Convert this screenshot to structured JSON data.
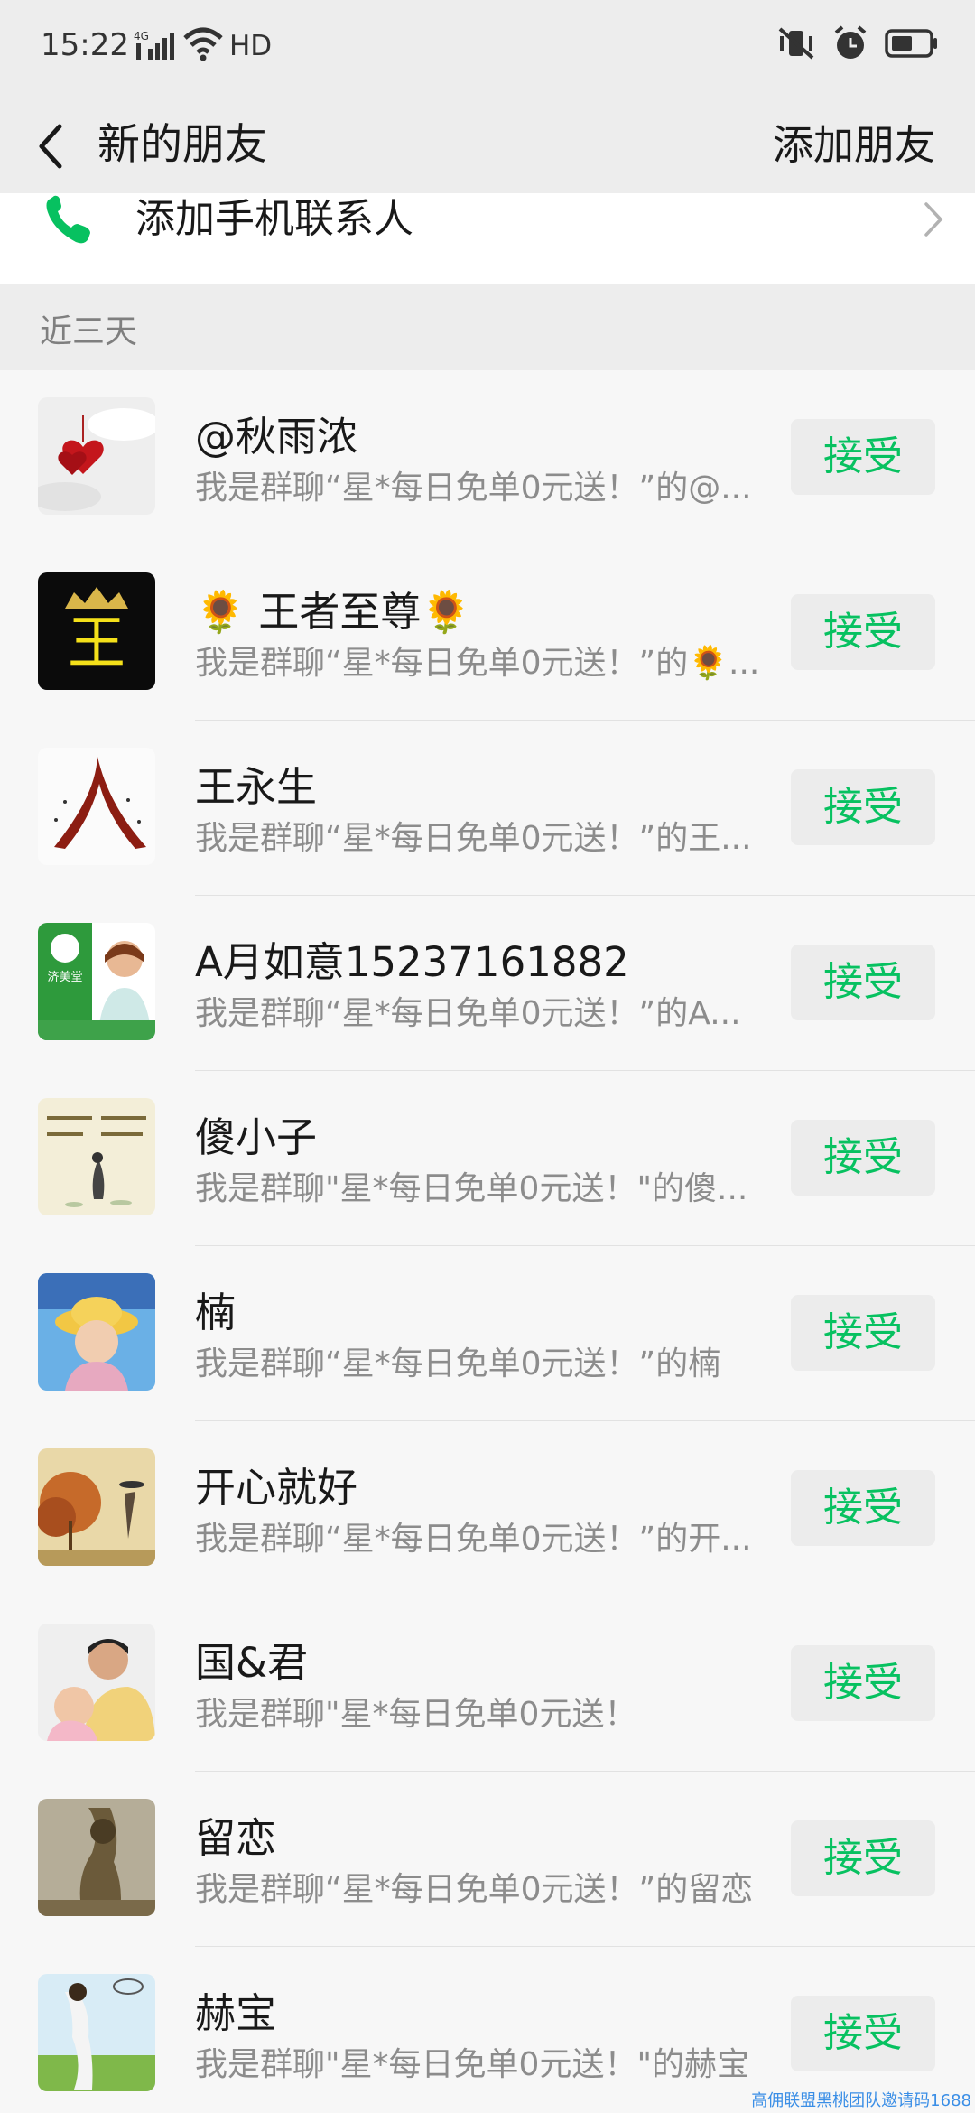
{
  "status_bar": {
    "time": "15:22",
    "network": "4G",
    "hd": "HD",
    "icons": [
      "signal-icon",
      "wifi-icon",
      "mute-vibrate-icon",
      "alarm-icon",
      "battery-icon"
    ]
  },
  "nav": {
    "title": "新的朋友",
    "add_friend": "添加朋友"
  },
  "phone_contacts": {
    "label": "添加手机联系人",
    "icon": "phone-icon",
    "icon_color": "#07c160"
  },
  "section": {
    "label": "近三天"
  },
  "accept_label": "接受",
  "accent_color": "#07c160",
  "requests": [
    {
      "name": "@秋雨浓",
      "message": "我是群聊“星*每日免单0元送！”的@..."
    },
    {
      "name": "🌻 王者至尊🌻",
      "message": "我是群聊“星*每日免单0元送！”的🌻..."
    },
    {
      "name": "王永生",
      "message": "我是群聊“星*每日免单0元送！”的王..."
    },
    {
      "name": "A月如意15237161882",
      "message": "我是群聊“星*每日免单0元送！”的A..."
    },
    {
      "name": "傻小子",
      "message": "我是群聊\"星*每日免单0元送！\"的傻..."
    },
    {
      "name": "楠",
      "message": "我是群聊“星*每日免单0元送！”的楠"
    },
    {
      "name": "开心就好",
      "message": "我是群聊“星*每日免单0元送！”的开..."
    },
    {
      "name": "国&君",
      "message": "我是群聊\"星*每日免单0元送！"
    },
    {
      "name": "留恋",
      "message": "我是群聊“星*每日免单0元送！”的留恋"
    },
    {
      "name": "赫宝",
      "message": "我是群聊\"星*每日免单0元送！\"的赫宝"
    }
  ],
  "avatar_labels": {
    "king": "王",
    "brand": "济美堂"
  },
  "watermark": "高佣联盟黑桃团队邀请码1688"
}
